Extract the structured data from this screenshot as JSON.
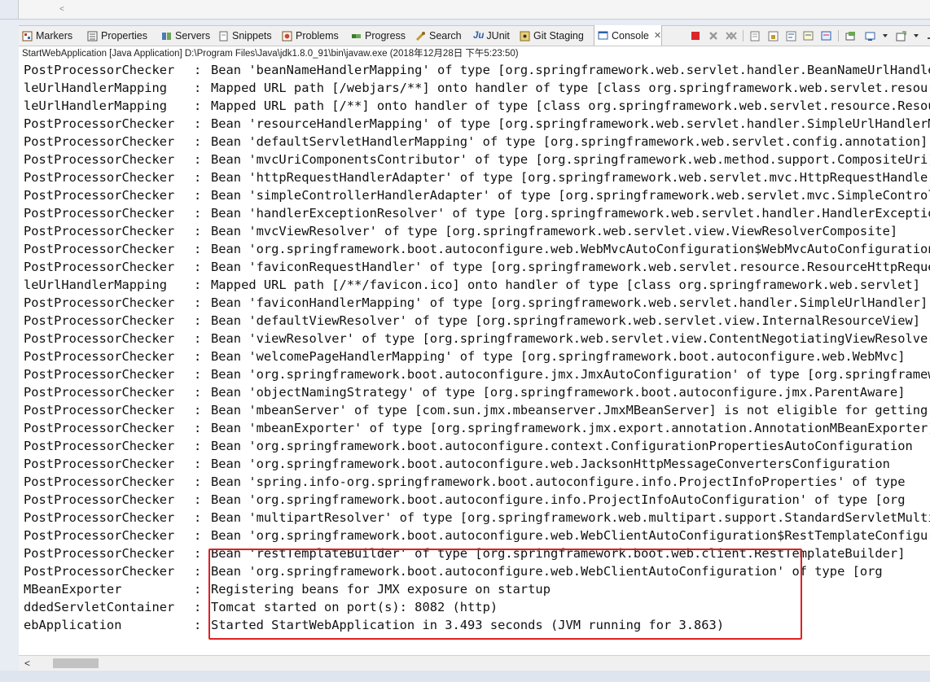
{
  "top_strip": {
    "scroll_left_glyph": "<"
  },
  "tabs": [
    {
      "label": "Markers",
      "icon": "markers-icon"
    },
    {
      "label": "Properties",
      "icon": "properties-icon"
    },
    {
      "label": "Servers",
      "icon": "servers-icon"
    },
    {
      "label": "Snippets",
      "icon": "snippets-icon"
    },
    {
      "label": "Problems",
      "icon": "problems-icon"
    },
    {
      "label": "Progress",
      "icon": "progress-icon"
    },
    {
      "label": "Search",
      "icon": "search-icon"
    },
    {
      "label": "JUnit",
      "icon": "junit-icon",
      "prefix": "Ju"
    },
    {
      "label": "Git Staging",
      "icon": "git-staging-icon"
    },
    {
      "label": "Console",
      "icon": "console-icon",
      "active": true,
      "close": "✕"
    }
  ],
  "process_label": "StartWebApplication [Java Application] D:\\Program Files\\Java\\jdk1.8.0_91\\bin\\javaw.exe (2018年12月28日 下午5:23:50)",
  "console": {
    "lines": [
      {
        "cls": "PostProcessorChecker",
        "msg": "Bean 'beanNameHandlerMapping' of type [org.springframework.web.servlet.handler.BeanNameUrlHandlerMapping]"
      },
      {
        "cls": "leUrlHandlerMapping",
        "msg": "Mapped URL path [/webjars/**] onto handler of type [class org.springframework.web.servlet.resource.ResourceHttpRequestHandler]"
      },
      {
        "cls": "leUrlHandlerMapping",
        "msg": "Mapped URL path [/**] onto handler of type [class org.springframework.web.servlet.resource.ResourceHttpRequestHandler]"
      },
      {
        "cls": "PostProcessorChecker",
        "msg": "Bean 'resourceHandlerMapping' of type [org.springframework.web.servlet.handler.SimpleUrlHandlerMapping]"
      },
      {
        "cls": "PostProcessorChecker",
        "msg": "Bean 'defaultServletHandlerMapping' of type [org.springframework.web.servlet.config.annotation]"
      },
      {
        "cls": "PostProcessorChecker",
        "msg": "Bean 'mvcUriComponentsContributor' of type [org.springframework.web.method.support.CompositeUri]"
      },
      {
        "cls": "PostProcessorChecker",
        "msg": "Bean 'httpRequestHandlerAdapter' of type [org.springframework.web.servlet.mvc.HttpRequestHandlerAdapter]"
      },
      {
        "cls": "PostProcessorChecker",
        "msg": "Bean 'simpleControllerHandlerAdapter' of type [org.springframework.web.servlet.mvc.SimpleController]"
      },
      {
        "cls": "PostProcessorChecker",
        "msg": "Bean 'handlerExceptionResolver' of type [org.springframework.web.servlet.handler.HandlerException]"
      },
      {
        "cls": "PostProcessorChecker",
        "msg": "Bean 'mvcViewResolver' of type [org.springframework.web.servlet.view.ViewResolverComposite]"
      },
      {
        "cls": "PostProcessorChecker",
        "msg": "Bean 'org.springframework.boot.autoconfigure.web.WebMvcAutoConfiguration$WebMvcAutoConfiguration"
      },
      {
        "cls": "PostProcessorChecker",
        "msg": "Bean 'faviconRequestHandler' of type [org.springframework.web.servlet.resource.ResourceHttpRequest]"
      },
      {
        "cls": "leUrlHandlerMapping",
        "msg": "Mapped URL path [/**/favicon.ico] onto handler of type [class org.springframework.web.servlet]"
      },
      {
        "cls": "PostProcessorChecker",
        "msg": "Bean 'faviconHandlerMapping' of type [org.springframework.web.servlet.handler.SimpleUrlHandler]"
      },
      {
        "cls": "PostProcessorChecker",
        "msg": "Bean 'defaultViewResolver' of type [org.springframework.web.servlet.view.InternalResourceView]"
      },
      {
        "cls": "PostProcessorChecker",
        "msg": "Bean 'viewResolver' of type [org.springframework.web.servlet.view.ContentNegotiatingViewResolver]"
      },
      {
        "cls": "PostProcessorChecker",
        "msg": "Bean 'welcomePageHandlerMapping' of type [org.springframework.boot.autoconfigure.web.WebMvc]"
      },
      {
        "cls": "PostProcessorChecker",
        "msg": "Bean 'org.springframework.boot.autoconfigure.jmx.JmxAutoConfiguration' of type [org.springframework]"
      },
      {
        "cls": "PostProcessorChecker",
        "msg": "Bean 'objectNamingStrategy' of type [org.springframework.boot.autoconfigure.jmx.ParentAware]"
      },
      {
        "cls": "PostProcessorChecker",
        "msg": "Bean 'mbeanServer' of type [com.sun.jmx.mbeanserver.JmxMBeanServer] is not eligible for getting"
      },
      {
        "cls": "PostProcessorChecker",
        "msg": "Bean 'mbeanExporter' of type [org.springframework.jmx.export.annotation.AnnotationMBeanExporter]"
      },
      {
        "cls": "PostProcessorChecker",
        "msg": "Bean 'org.springframework.boot.autoconfigure.context.ConfigurationPropertiesAutoConfiguration"
      },
      {
        "cls": "PostProcessorChecker",
        "msg": "Bean 'org.springframework.boot.autoconfigure.web.JacksonHttpMessageConvertersConfiguration"
      },
      {
        "cls": "PostProcessorChecker",
        "msg": "Bean 'spring.info-org.springframework.boot.autoconfigure.info.ProjectInfoProperties' of type"
      },
      {
        "cls": "PostProcessorChecker",
        "msg": "Bean 'org.springframework.boot.autoconfigure.info.ProjectInfoAutoConfiguration' of type [org"
      },
      {
        "cls": "PostProcessorChecker",
        "msg": "Bean 'multipartResolver' of type [org.springframework.web.multipart.support.StandardServletMultipart]"
      },
      {
        "cls": "PostProcessorChecker",
        "msg": "Bean 'org.springframework.boot.autoconfigure.web.WebClientAutoConfiguration$RestTemplateConfiguration"
      },
      {
        "cls": "PostProcessorChecker",
        "msg": "Bean 'restTemplateBuilder' of type [org.springframework.boot.web.client.RestTemplateBuilder]"
      },
      {
        "cls": "PostProcessorChecker",
        "msg": "Bean 'org.springframework.boot.autoconfigure.web.WebClientAutoConfiguration' of type [org"
      },
      {
        "cls": "MBeanExporter",
        "msg": "Registering beans for JMX exposure on startup"
      },
      {
        "cls": "ddedServletContainer",
        "msg": "Tomcat started on port(s): 8082 (http)"
      },
      {
        "cls": "ebApplication",
        "msg": "Started StartWebApplication in 3.493 seconds (JVM running for 3.863)"
      }
    ]
  },
  "scrollbar": {
    "left_arrow": "<"
  }
}
